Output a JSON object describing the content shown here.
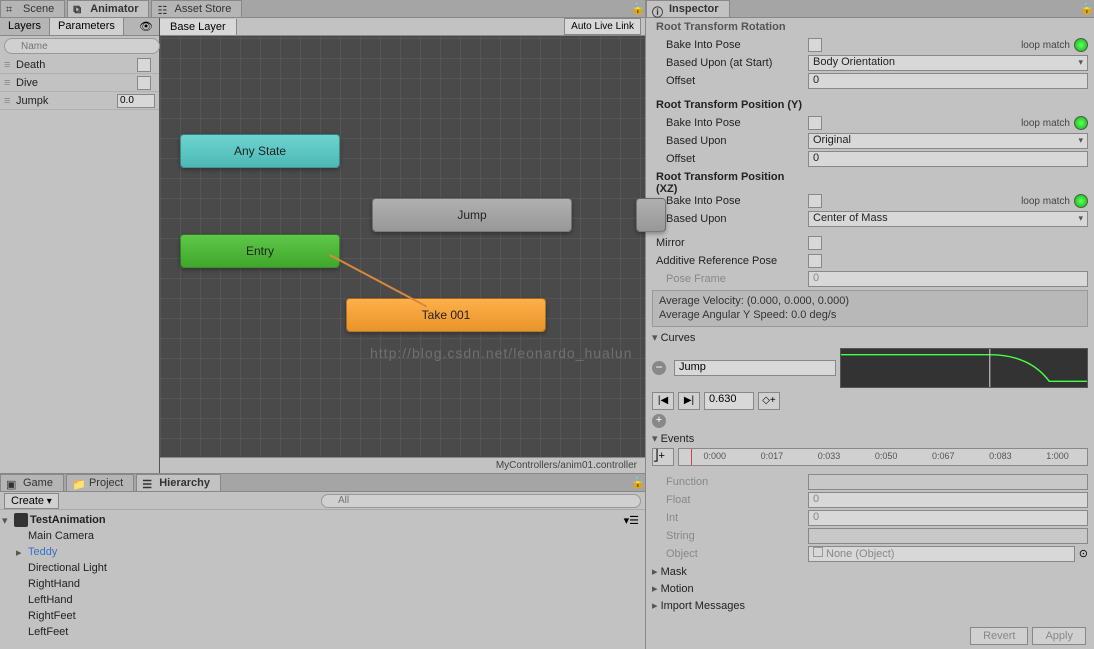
{
  "tabs_top_left": {
    "scene": "Scene",
    "animator": "Animator",
    "assetstore": "Asset Store"
  },
  "tabs_top_right": {
    "inspector": "Inspector"
  },
  "animator_sidebar": {
    "layers_label": "Layers",
    "parameters_label": "Parameters",
    "search_placeholder": "Name",
    "params": [
      {
        "name": "Death",
        "type": "bool"
      },
      {
        "name": "Dive",
        "type": "bool"
      },
      {
        "name": "Jumpk",
        "type": "float",
        "value": "0.0"
      }
    ]
  },
  "graph": {
    "breadcrumb": "Base Layer",
    "autolive": "Auto Live Link",
    "anystate": "Any State",
    "entry": "Entry",
    "jump": "Jump",
    "take": "Take 001",
    "footer": "MyControllers/anim01.controller",
    "watermark": "http://blog.csdn.net/leonardo_hualun"
  },
  "bottom_tabs": {
    "game": "Game",
    "project": "Project",
    "hierarchy": "Hierarchy"
  },
  "hierarchy": {
    "create": "Create",
    "search_placeholder": "All",
    "root": "TestAnimation",
    "items": [
      "Main Camera",
      "Teddy",
      "Directional Light",
      "RightHand",
      "LeftHand",
      "RightFeet",
      "LeftFeet"
    ]
  },
  "inspector": {
    "root_rot_header": "Root Transform Rotation",
    "root_posy_header": "Root Transform Position (Y)",
    "root_posxz_header": "Root Transform Position (XZ)",
    "bake": "Bake Into Pose",
    "based_upon_at_start": "Based Upon (at Start)",
    "based_upon": "Based Upon",
    "offset": "Offset",
    "body_orientation": "Body Orientation",
    "original": "Original",
    "center_of_mass": "Center of Mass",
    "offset_val": "0",
    "loopmatch": "loop match",
    "mirror": "Mirror",
    "additive_ref": "Additive Reference Pose",
    "pose_frame": "Pose Frame",
    "pose_frame_val": "0",
    "avg_velocity": "Average Velocity: (0.000, 0.000, 0.000)",
    "avg_angular": "Average Angular Y Speed: 0.0 deg/s",
    "curves": "Curves",
    "curve_name": "Jump",
    "playback_time": "0.630",
    "events": "Events",
    "timeline_ticks": [
      "0:000",
      "0:017",
      "0:033",
      "0:050",
      "0:067",
      "0:083",
      "1:000"
    ],
    "function": "Function",
    "float": "Float",
    "int": "Int",
    "string": "String",
    "object": "Object",
    "float_val": "0",
    "int_val": "0",
    "object_val": "None (Object)",
    "mask": "Mask",
    "motion": "Motion",
    "import_messages": "Import Messages",
    "revert": "Revert",
    "apply": "Apply"
  }
}
